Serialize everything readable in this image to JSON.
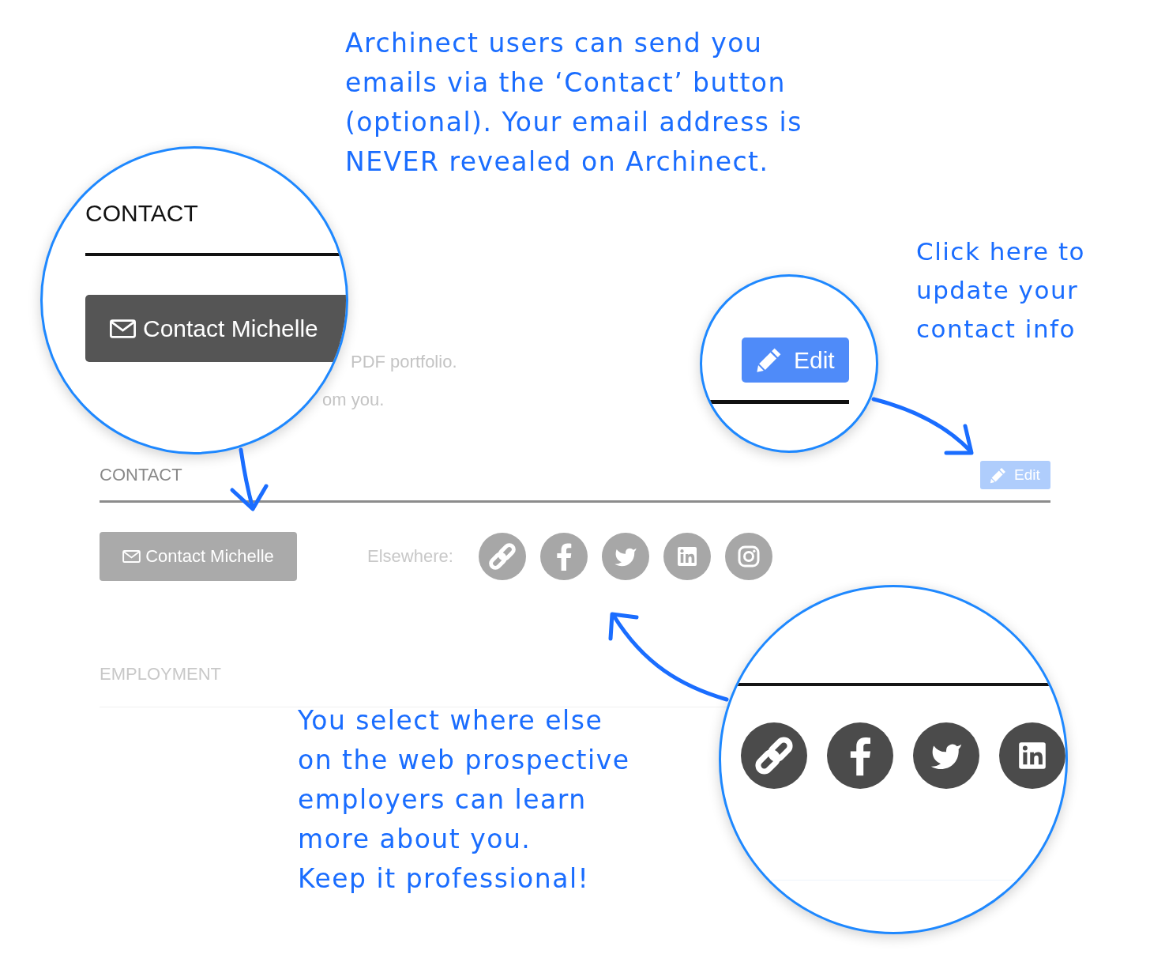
{
  "profile_page": {
    "intro_fragments": [
      "PDF portfolio.",
      "om you."
    ],
    "contact": {
      "heading": "CONTACT",
      "edit_button": "Edit",
      "contact_button": "Contact Michelle",
      "elsewhere_label": "Elsewhere:",
      "links": [
        {
          "kind": "link"
        },
        {
          "kind": "facebook"
        },
        {
          "kind": "twitter"
        },
        {
          "kind": "linkedin"
        },
        {
          "kind": "instagram"
        }
      ]
    },
    "employment": {
      "heading": "EMPLOYMENT"
    }
  },
  "magnifiers": [
    {
      "kind": "contact_button",
      "heading": "CONTACT",
      "button": "Contact Michelle"
    },
    {
      "kind": "edit_button",
      "button": "Edit"
    },
    {
      "kind": "social_links",
      "links": [
        {
          "kind": "link"
        },
        {
          "kind": "facebook"
        },
        {
          "kind": "twitter"
        },
        {
          "kind": "linkedin"
        }
      ]
    }
  ],
  "notes": [
    {
      "lines": [
        "Archinect users can send you",
        "emails via the ‘Contact’ button",
        "(optional). Your email address is",
        "NEVER revealed on Archinect."
      ]
    },
    {
      "lines": [
        "Click here to",
        "update your",
        "contact info"
      ]
    },
    {
      "lines": [
        "You select where else",
        "on the web prospective",
        "employers can learn",
        "more about you.",
        "Keep it professional!"
      ]
    }
  ]
}
